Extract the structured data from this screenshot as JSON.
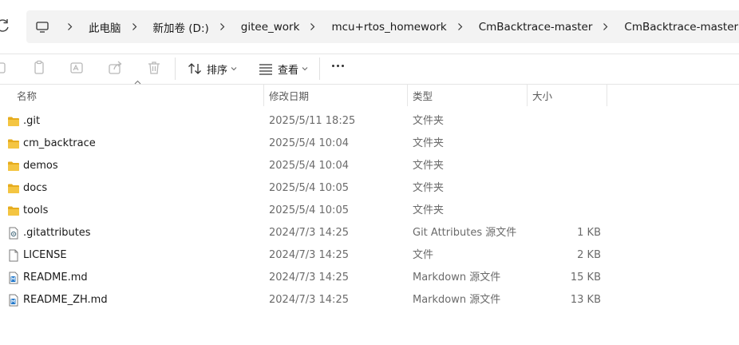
{
  "breadcrumbs": [
    "此电脑",
    "新加卷 (D:)",
    "gitee_work",
    "mcu+rtos_homework",
    "CmBacktrace-master",
    "CmBacktrace-master"
  ],
  "toolbar": {
    "sort_label": "排序",
    "view_label": "查看"
  },
  "columns": {
    "name": "名称",
    "date": "修改日期",
    "type": "类型",
    "size": "大小"
  },
  "files": [
    {
      "name": ".git",
      "date": "2025/5/11 18:25",
      "type": "文件夹",
      "size": "",
      "icon": "folder-icon"
    },
    {
      "name": "cm_backtrace",
      "date": "2025/5/4 10:04",
      "type": "文件夹",
      "size": "",
      "icon": "folder-icon"
    },
    {
      "name": "demos",
      "date": "2025/5/4 10:04",
      "type": "文件夹",
      "size": "",
      "icon": "folder-icon"
    },
    {
      "name": "docs",
      "date": "2025/5/4 10:05",
      "type": "文件夹",
      "size": "",
      "icon": "folder-icon"
    },
    {
      "name": "tools",
      "date": "2025/5/4 10:05",
      "type": "文件夹",
      "size": "",
      "icon": "folder-icon"
    },
    {
      "name": ".gitattributes",
      "date": "2024/7/3 14:25",
      "type": "Git Attributes 源文件",
      "size": "1 KB",
      "icon": "config-file-icon"
    },
    {
      "name": "LICENSE",
      "date": "2024/7/3 14:25",
      "type": "文件",
      "size": "2 KB",
      "icon": "blank-file-icon"
    },
    {
      "name": "README.md",
      "date": "2024/7/3 14:25",
      "type": "Markdown 源文件",
      "size": "15 KB",
      "icon": "markdown-file-icon"
    },
    {
      "name": "README_ZH.md",
      "date": "2024/7/3 14:25",
      "type": "Markdown 源文件",
      "size": "13 KB",
      "icon": "markdown-file-icon"
    }
  ],
  "colors": {
    "folder": "#f4c542",
    "folder_dark": "#e6ac1e",
    "accent": "#1a73c8"
  }
}
